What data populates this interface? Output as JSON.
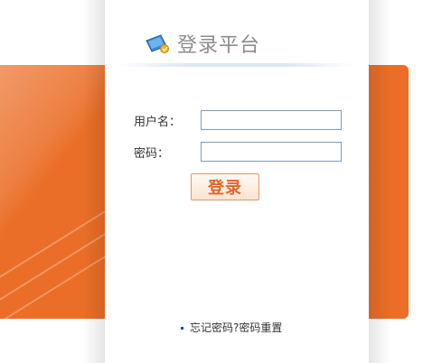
{
  "header": {
    "title": "登录平台",
    "icon": "login-platform-icon"
  },
  "form": {
    "username_label": "用户名：",
    "username_value": "",
    "password_label": "密码：",
    "password_value": "",
    "login_button": "登录"
  },
  "footer": {
    "link_text": "忘记密码?密码重置"
  },
  "colors": {
    "accent": "#ea6e27",
    "button_text": "#e0662a",
    "input_border": "#7f9db9"
  }
}
